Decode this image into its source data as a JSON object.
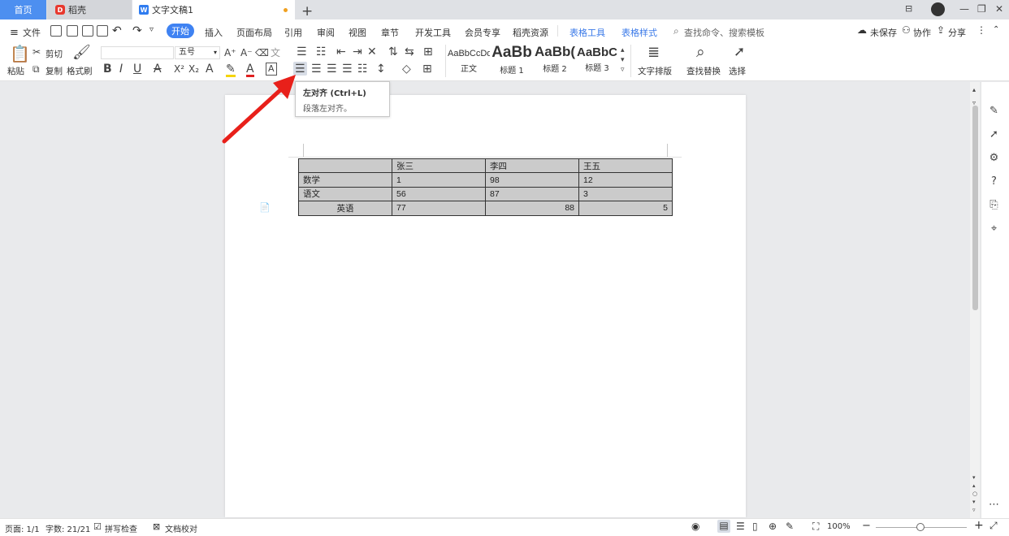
{
  "tabs": {
    "home": "首页",
    "daoke": "稻壳",
    "doc": "文字文稿1"
  },
  "menu": {
    "file": "文件",
    "start": "开始",
    "items": [
      "插入",
      "页面布局",
      "引用",
      "审阅",
      "视图",
      "章节",
      "开发工具",
      "会员专享",
      "稻壳资源"
    ],
    "table_tools": "表格工具",
    "table_style": "表格样式",
    "search": "查找命令、搜索模板",
    "unsaved": "未保存",
    "collab": "协作",
    "share": "分享"
  },
  "ribbon": {
    "paste": "粘贴",
    "cut": "剪切",
    "copy": "复制",
    "format_painter": "格式刷",
    "font_size": "五号",
    "styles": [
      {
        "sample": "AaBbCcDd",
        "name": "正文"
      },
      {
        "sample": "AaBb",
        "name": "标题 1"
      },
      {
        "sample": "AaBb(",
        "name": "标题 2"
      },
      {
        "sample": "AaBbC",
        "name": "标题 3"
      }
    ],
    "text_layout": "文字排版",
    "find_replace": "查找替换",
    "select": "选择"
  },
  "tooltip": {
    "title": "左对齐 (Ctrl+L)",
    "desc": "段落左对齐。"
  },
  "table": {
    "header": [
      "",
      "张三",
      "李四",
      "王五"
    ],
    "rows": [
      [
        "数学",
        "1",
        "98",
        "12"
      ],
      [
        "语文",
        "56",
        "87",
        "3"
      ],
      [
        "英语",
        "77",
        "88",
        "5"
      ]
    ]
  },
  "status": {
    "page": "页面: 1/1",
    "words": "字数: 21/21",
    "spell": "拼写检查",
    "proof": "文档校对",
    "zoom": "100%"
  },
  "colors": {
    "accent": "#3f82f2",
    "arrow": "#e8201a",
    "table_fill": "#cbcbcb"
  }
}
